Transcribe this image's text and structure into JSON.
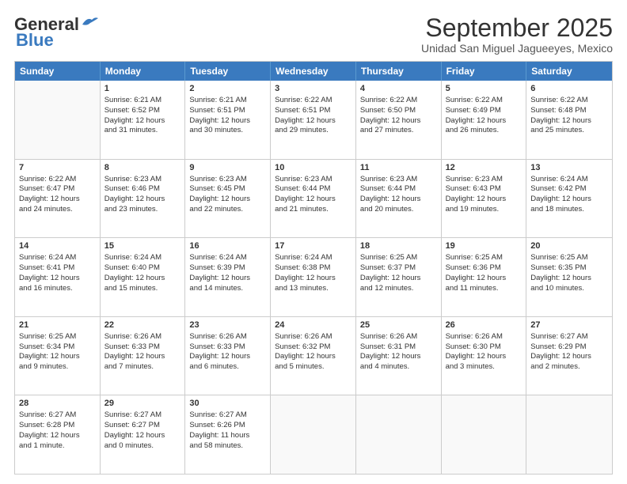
{
  "logo": {
    "line1": "General",
    "line2": "Blue"
  },
  "title": "September 2025",
  "subtitle": "Unidad San Miguel Jagueeyes, Mexico",
  "days": [
    "Sunday",
    "Monday",
    "Tuesday",
    "Wednesday",
    "Thursday",
    "Friday",
    "Saturday"
  ],
  "weeks": [
    [
      {
        "num": "",
        "empty": true,
        "lines": []
      },
      {
        "num": "1",
        "empty": false,
        "lines": [
          "Sunrise: 6:21 AM",
          "Sunset: 6:52 PM",
          "Daylight: 12 hours",
          "and 31 minutes."
        ]
      },
      {
        "num": "2",
        "empty": false,
        "lines": [
          "Sunrise: 6:21 AM",
          "Sunset: 6:51 PM",
          "Daylight: 12 hours",
          "and 30 minutes."
        ]
      },
      {
        "num": "3",
        "empty": false,
        "lines": [
          "Sunrise: 6:22 AM",
          "Sunset: 6:51 PM",
          "Daylight: 12 hours",
          "and 29 minutes."
        ]
      },
      {
        "num": "4",
        "empty": false,
        "lines": [
          "Sunrise: 6:22 AM",
          "Sunset: 6:50 PM",
          "Daylight: 12 hours",
          "and 27 minutes."
        ]
      },
      {
        "num": "5",
        "empty": false,
        "lines": [
          "Sunrise: 6:22 AM",
          "Sunset: 6:49 PM",
          "Daylight: 12 hours",
          "and 26 minutes."
        ]
      },
      {
        "num": "6",
        "empty": false,
        "lines": [
          "Sunrise: 6:22 AM",
          "Sunset: 6:48 PM",
          "Daylight: 12 hours",
          "and 25 minutes."
        ]
      }
    ],
    [
      {
        "num": "7",
        "empty": false,
        "lines": [
          "Sunrise: 6:22 AM",
          "Sunset: 6:47 PM",
          "Daylight: 12 hours",
          "and 24 minutes."
        ]
      },
      {
        "num": "8",
        "empty": false,
        "lines": [
          "Sunrise: 6:23 AM",
          "Sunset: 6:46 PM",
          "Daylight: 12 hours",
          "and 23 minutes."
        ]
      },
      {
        "num": "9",
        "empty": false,
        "lines": [
          "Sunrise: 6:23 AM",
          "Sunset: 6:45 PM",
          "Daylight: 12 hours",
          "and 22 minutes."
        ]
      },
      {
        "num": "10",
        "empty": false,
        "lines": [
          "Sunrise: 6:23 AM",
          "Sunset: 6:44 PM",
          "Daylight: 12 hours",
          "and 21 minutes."
        ]
      },
      {
        "num": "11",
        "empty": false,
        "lines": [
          "Sunrise: 6:23 AM",
          "Sunset: 6:44 PM",
          "Daylight: 12 hours",
          "and 20 minutes."
        ]
      },
      {
        "num": "12",
        "empty": false,
        "lines": [
          "Sunrise: 6:23 AM",
          "Sunset: 6:43 PM",
          "Daylight: 12 hours",
          "and 19 minutes."
        ]
      },
      {
        "num": "13",
        "empty": false,
        "lines": [
          "Sunrise: 6:24 AM",
          "Sunset: 6:42 PM",
          "Daylight: 12 hours",
          "and 18 minutes."
        ]
      }
    ],
    [
      {
        "num": "14",
        "empty": false,
        "lines": [
          "Sunrise: 6:24 AM",
          "Sunset: 6:41 PM",
          "Daylight: 12 hours",
          "and 16 minutes."
        ]
      },
      {
        "num": "15",
        "empty": false,
        "lines": [
          "Sunrise: 6:24 AM",
          "Sunset: 6:40 PM",
          "Daylight: 12 hours",
          "and 15 minutes."
        ]
      },
      {
        "num": "16",
        "empty": false,
        "lines": [
          "Sunrise: 6:24 AM",
          "Sunset: 6:39 PM",
          "Daylight: 12 hours",
          "and 14 minutes."
        ]
      },
      {
        "num": "17",
        "empty": false,
        "lines": [
          "Sunrise: 6:24 AM",
          "Sunset: 6:38 PM",
          "Daylight: 12 hours",
          "and 13 minutes."
        ]
      },
      {
        "num": "18",
        "empty": false,
        "lines": [
          "Sunrise: 6:25 AM",
          "Sunset: 6:37 PM",
          "Daylight: 12 hours",
          "and 12 minutes."
        ]
      },
      {
        "num": "19",
        "empty": false,
        "lines": [
          "Sunrise: 6:25 AM",
          "Sunset: 6:36 PM",
          "Daylight: 12 hours",
          "and 11 minutes."
        ]
      },
      {
        "num": "20",
        "empty": false,
        "lines": [
          "Sunrise: 6:25 AM",
          "Sunset: 6:35 PM",
          "Daylight: 12 hours",
          "and 10 minutes."
        ]
      }
    ],
    [
      {
        "num": "21",
        "empty": false,
        "lines": [
          "Sunrise: 6:25 AM",
          "Sunset: 6:34 PM",
          "Daylight: 12 hours",
          "and 9 minutes."
        ]
      },
      {
        "num": "22",
        "empty": false,
        "lines": [
          "Sunrise: 6:26 AM",
          "Sunset: 6:33 PM",
          "Daylight: 12 hours",
          "and 7 minutes."
        ]
      },
      {
        "num": "23",
        "empty": false,
        "lines": [
          "Sunrise: 6:26 AM",
          "Sunset: 6:33 PM",
          "Daylight: 12 hours",
          "and 6 minutes."
        ]
      },
      {
        "num": "24",
        "empty": false,
        "lines": [
          "Sunrise: 6:26 AM",
          "Sunset: 6:32 PM",
          "Daylight: 12 hours",
          "and 5 minutes."
        ]
      },
      {
        "num": "25",
        "empty": false,
        "lines": [
          "Sunrise: 6:26 AM",
          "Sunset: 6:31 PM",
          "Daylight: 12 hours",
          "and 4 minutes."
        ]
      },
      {
        "num": "26",
        "empty": false,
        "lines": [
          "Sunrise: 6:26 AM",
          "Sunset: 6:30 PM",
          "Daylight: 12 hours",
          "and 3 minutes."
        ]
      },
      {
        "num": "27",
        "empty": false,
        "lines": [
          "Sunrise: 6:27 AM",
          "Sunset: 6:29 PM",
          "Daylight: 12 hours",
          "and 2 minutes."
        ]
      }
    ],
    [
      {
        "num": "28",
        "empty": false,
        "lines": [
          "Sunrise: 6:27 AM",
          "Sunset: 6:28 PM",
          "Daylight: 12 hours",
          "and 1 minute."
        ]
      },
      {
        "num": "29",
        "empty": false,
        "lines": [
          "Sunrise: 6:27 AM",
          "Sunset: 6:27 PM",
          "Daylight: 12 hours",
          "and 0 minutes."
        ]
      },
      {
        "num": "30",
        "empty": false,
        "lines": [
          "Sunrise: 6:27 AM",
          "Sunset: 6:26 PM",
          "Daylight: 11 hours",
          "and 58 minutes."
        ]
      },
      {
        "num": "",
        "empty": true,
        "lines": []
      },
      {
        "num": "",
        "empty": true,
        "lines": []
      },
      {
        "num": "",
        "empty": true,
        "lines": []
      },
      {
        "num": "",
        "empty": true,
        "lines": []
      }
    ]
  ]
}
